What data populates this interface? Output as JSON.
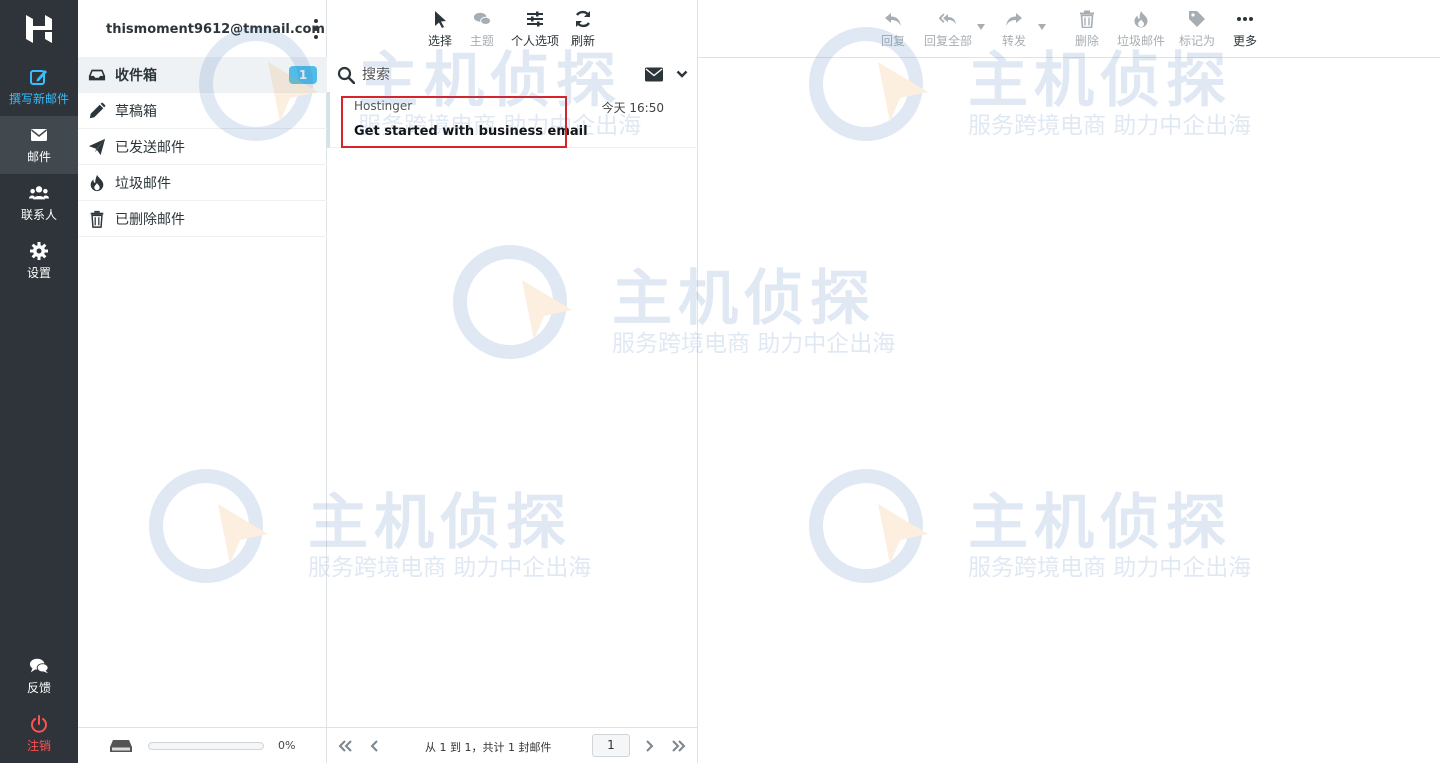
{
  "nav": {
    "compose": "撰写新邮件",
    "mail": "邮件",
    "contacts": "联系人",
    "settings": "设置",
    "feedback": "反馈",
    "logout": "注销"
  },
  "account": {
    "email": "thismoment9612@tmnail.com"
  },
  "folders": [
    {
      "label": "收件箱",
      "icon": "inbox-icon",
      "unread": "1",
      "selected": true
    },
    {
      "label": "草稿箱",
      "icon": "pencil-icon"
    },
    {
      "label": "已发送邮件",
      "icon": "paper-plane-icon"
    },
    {
      "label": "垃圾邮件",
      "icon": "fire-icon"
    },
    {
      "label": "已删除邮件",
      "icon": "trash-icon"
    }
  ],
  "quota": {
    "percent_label": "0%",
    "used_fraction": 0.0
  },
  "list_toolbar": {
    "select": "选择",
    "threads": "主题",
    "options": "个人选项",
    "refresh": "刷新"
  },
  "search": {
    "placeholder": "搜索"
  },
  "messages": [
    {
      "from": "Hostinger",
      "date": "今天 16:50",
      "subject": "Get started with business email"
    }
  ],
  "pager": {
    "info": "从 1 到 1，共计 1 封邮件",
    "page": "1"
  },
  "preview_toolbar": {
    "reply": "回复",
    "reply_all": "回复全部",
    "forward": "转发",
    "delete": "删除",
    "junk": "垃圾邮件",
    "mark": "标记为",
    "more": "更多"
  },
  "watermark": {
    "brand": "主机侦探",
    "slogan": "服务跨境电商 助力中企出海"
  },
  "colors": {
    "nav_bg": "#2e3439",
    "accent": "#37beff",
    "badge": "#4fbde8",
    "logout": "#ff5252",
    "highlight_box": "#d8232a"
  }
}
